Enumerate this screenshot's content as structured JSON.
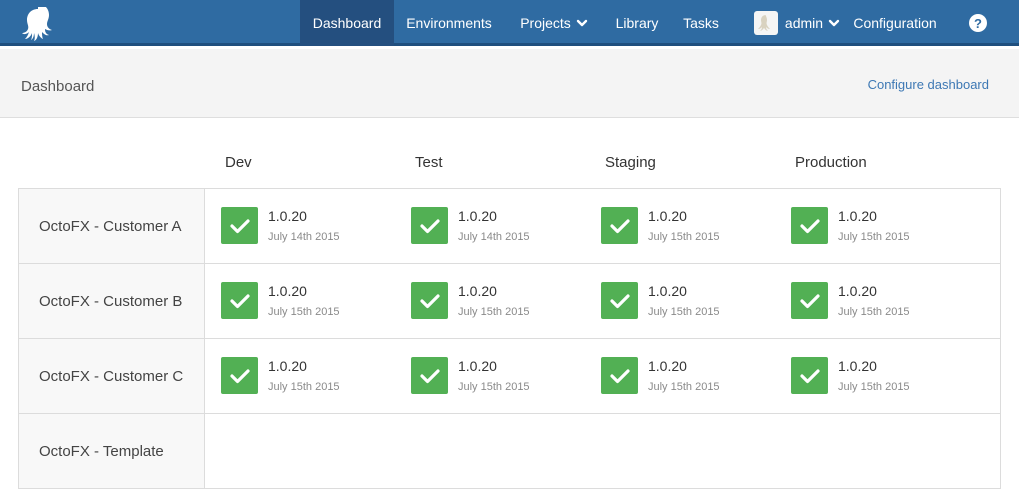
{
  "nav": {
    "items": [
      {
        "label": "Dashboard",
        "active": true
      },
      {
        "label": "Environments"
      },
      {
        "label": "Projects",
        "dropdown": true
      },
      {
        "label": "Library"
      },
      {
        "label": "Tasks"
      },
      {
        "label": "admin",
        "dropdown": true,
        "avatar": true
      },
      {
        "label": "Configuration"
      }
    ],
    "help_label": "?"
  },
  "page": {
    "title": "Dashboard",
    "configure_label": "Configure dashboard"
  },
  "environments": [
    "Dev",
    "Test",
    "Staging",
    "Production"
  ],
  "projects": [
    {
      "name": "OctoFX - Customer A",
      "deployments": [
        {
          "version": "1.0.20",
          "date": "July 14th 2015"
        },
        {
          "version": "1.0.20",
          "date": "July 14th 2015"
        },
        {
          "version": "1.0.20",
          "date": "July 15th 2015"
        },
        {
          "version": "1.0.20",
          "date": "July 15th 2015"
        }
      ]
    },
    {
      "name": "OctoFX - Customer B",
      "deployments": [
        {
          "version": "1.0.20",
          "date": "July 15th 2015"
        },
        {
          "version": "1.0.20",
          "date": "July 15th 2015"
        },
        {
          "version": "1.0.20",
          "date": "July 15th 2015"
        },
        {
          "version": "1.0.20",
          "date": "July 15th 2015"
        }
      ]
    },
    {
      "name": "OctoFX - Customer C",
      "deployments": [
        {
          "version": "1.0.20",
          "date": "July 15th 2015"
        },
        {
          "version": "1.0.20",
          "date": "July 15th 2015"
        },
        {
          "version": "1.0.20",
          "date": "July 15th 2015"
        },
        {
          "version": "1.0.20",
          "date": "July 15th 2015"
        }
      ]
    },
    {
      "name": "OctoFX - Template",
      "deployments": []
    }
  ],
  "colors": {
    "nav": "#2f6ba2",
    "nav_active": "#244f7f",
    "success": "#52b054",
    "link": "#3d78b4"
  }
}
